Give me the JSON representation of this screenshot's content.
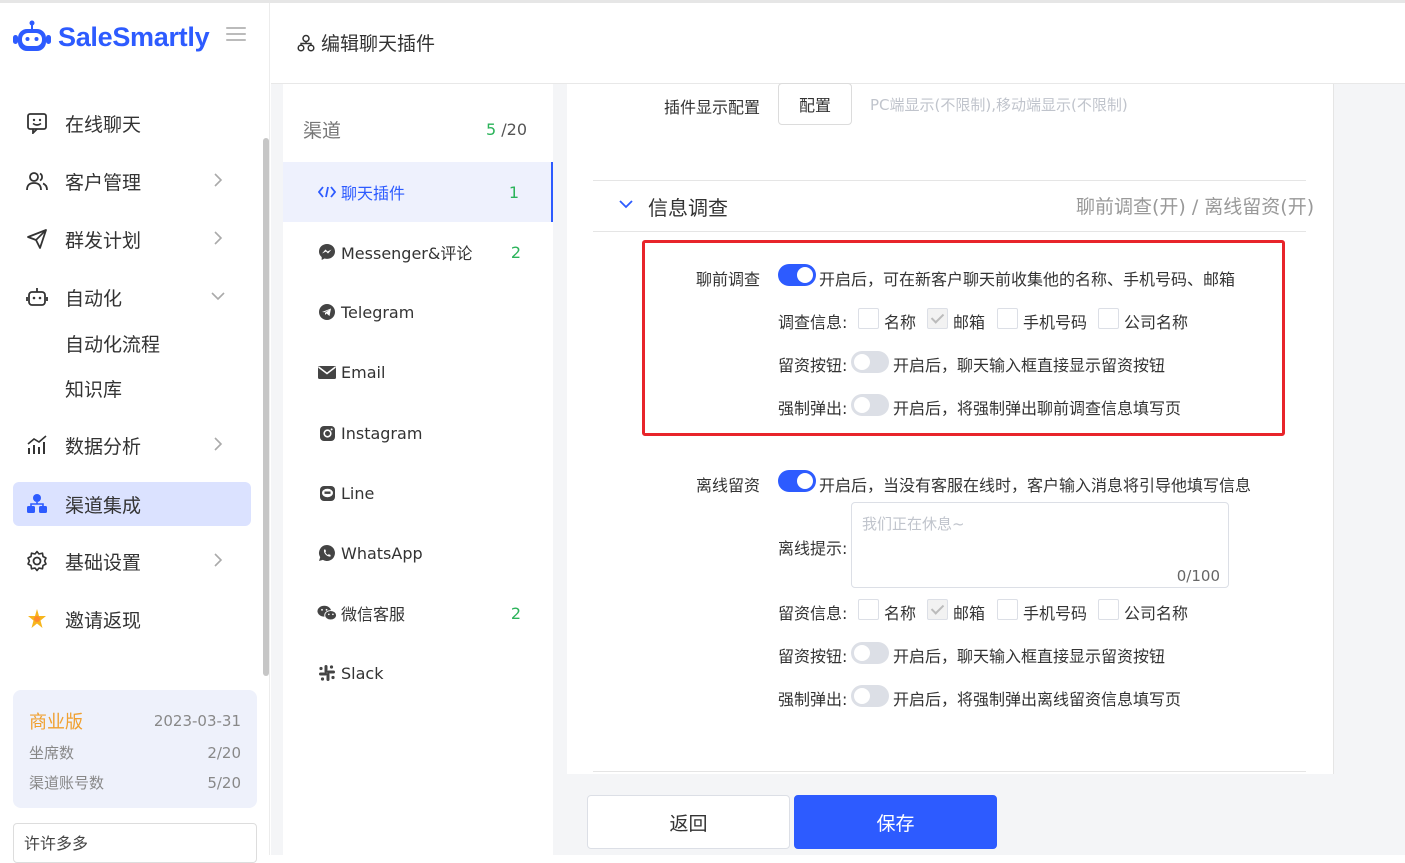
{
  "brand": {
    "name": "SaleSmartly",
    "color": "#2d5bff"
  },
  "sidebar": {
    "items": [
      {
        "label": "在线聊天",
        "icon": "chat-smile-icon",
        "arrow": false
      },
      {
        "label": "客户管理",
        "icon": "users-icon",
        "arrow": true
      },
      {
        "label": "群发计划",
        "icon": "send-icon",
        "arrow": true
      },
      {
        "label": "自动化",
        "icon": "robot-icon",
        "arrow": true,
        "expanded": true
      },
      {
        "label": "数据分析",
        "icon": "chart-icon",
        "arrow": true
      },
      {
        "label": "渠道集成",
        "icon": "integration-icon",
        "arrow": false,
        "active": true
      },
      {
        "label": "基础设置",
        "icon": "gear-icon",
        "arrow": true
      },
      {
        "label": "邀请返现",
        "icon": "sparkle-icon",
        "arrow": false
      }
    ],
    "sub_items": [
      "自动化流程",
      "知识库"
    ],
    "plan": {
      "version": "商业版",
      "expires": "2023-03-31",
      "seats_label": "坐席数",
      "seats_value": "2/20",
      "channels_label": "渠道账号数",
      "channels_value": "5/20"
    },
    "user": "许许多多"
  },
  "header": {
    "title": "编辑聊天插件"
  },
  "channels": {
    "heading": "渠道",
    "used": "5",
    "total": " /20",
    "items": [
      {
        "label": "聊天插件",
        "count": "1",
        "icon": "code-icon",
        "active": true
      },
      {
        "label": "Messenger&评论",
        "count": "2",
        "icon": "messenger-icon"
      },
      {
        "label": "Telegram",
        "count": "",
        "icon": "telegram-icon"
      },
      {
        "label": "Email",
        "count": "",
        "icon": "email-icon"
      },
      {
        "label": "Instagram",
        "count": "",
        "icon": "instagram-icon"
      },
      {
        "label": "Line",
        "count": "",
        "icon": "line-icon"
      },
      {
        "label": "WhatsApp",
        "count": "",
        "icon": "whatsapp-icon"
      },
      {
        "label": "微信客服",
        "count": "2",
        "icon": "wechat-icon"
      },
      {
        "label": "Slack",
        "count": "",
        "icon": "slack-icon"
      }
    ]
  },
  "main": {
    "display_config_label": "插件显示配置",
    "config_button": "配置",
    "display_config_hint": "PC端显示(不限制),移动端显示(不限制)",
    "section_title": "信息调查",
    "section_status": "聊前调查(开) / 离线留资(开)",
    "pre_chat": {
      "label": "聊前调查",
      "enabled": true,
      "desc": "开启后，可在新客户聊天前收集他的名称、手机号码、邮箱",
      "info_label": "调查信息:",
      "fields": [
        {
          "label": "名称",
          "checked": false
        },
        {
          "label": "邮箱",
          "checked": true
        },
        {
          "label": "手机号码",
          "checked": false
        },
        {
          "label": "公司名称",
          "checked": false
        }
      ],
      "button_label": "留资按钮:",
      "button_enabled": false,
      "button_desc": "开启后，聊天输入框直接显示留资按钮",
      "popup_label": "强制弹出:",
      "popup_enabled": false,
      "popup_desc": "开启后，将强制弹出聊前调查信息填写页"
    },
    "offline": {
      "label": "离线留资",
      "enabled": true,
      "desc": "开启后，当没有客服在线时，客户输入消息将引导他填写信息",
      "prompt_label": "离线提示:",
      "prompt_placeholder": "我们正在休息~",
      "prompt_counter": "0/100",
      "info_label": "留资信息:",
      "fields": [
        {
          "label": "名称",
          "checked": false
        },
        {
          "label": "邮箱",
          "checked": true
        },
        {
          "label": "手机号码",
          "checked": false
        },
        {
          "label": "公司名称",
          "checked": false
        }
      ],
      "button_label": "留资按钮:",
      "button_enabled": false,
      "button_desc": "开启后，聊天输入框直接显示留资按钮",
      "popup_label": "强制弹出:",
      "popup_enabled": false,
      "popup_desc": "开启后，将强制弹出离线留资信息填写页"
    }
  },
  "footer": {
    "back": "返回",
    "save": "保存"
  },
  "colors": {
    "accent": "#2d5bff",
    "success": "#2bb35a",
    "highlight_border": "#e8242a",
    "plan_version": "#f0a030"
  }
}
